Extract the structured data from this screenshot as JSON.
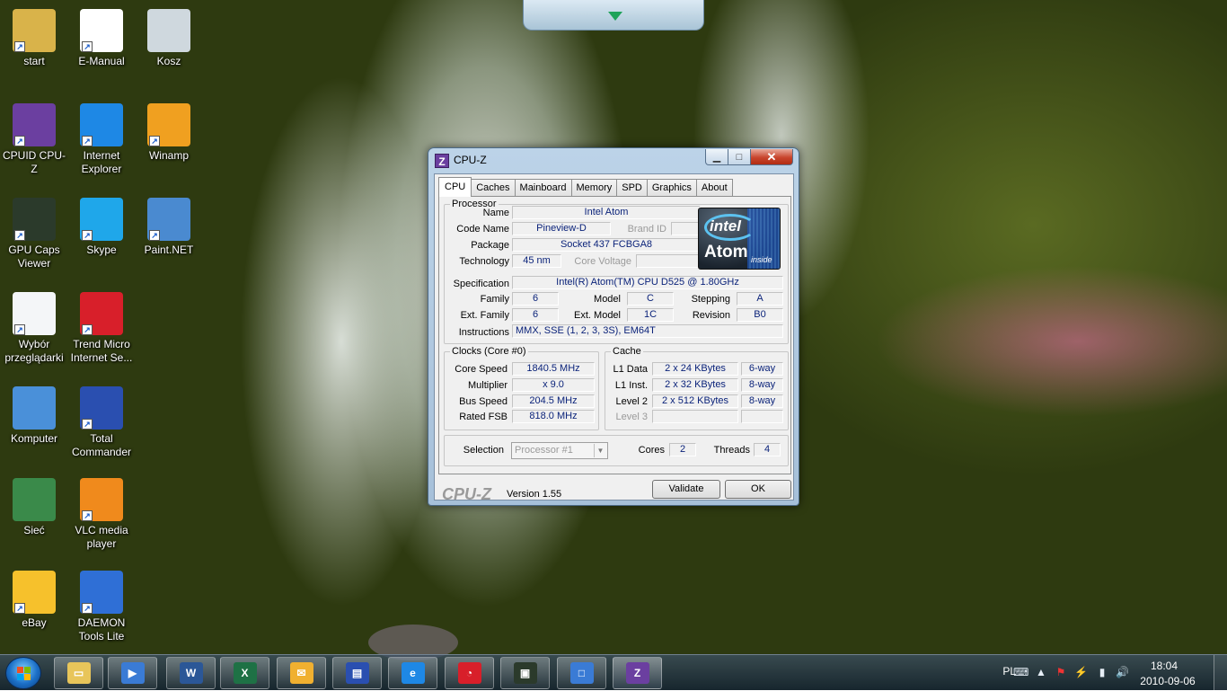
{
  "desktop": {
    "icons": [
      {
        "label": "start",
        "icon": "user-folder-icon",
        "color": "#d9b34a"
      },
      {
        "label": "E-Manual",
        "icon": "pdf-document-icon",
        "color": "#ffffff"
      },
      {
        "label": "Kosz",
        "icon": "recycle-bin-icon",
        "color": "#cfd8de"
      },
      {
        "label": "CPUID CPU-Z",
        "icon": "cpuz-icon",
        "color": "#6b3fa0"
      },
      {
        "label": "Internet Explorer",
        "icon": "internet-explorer-icon",
        "color": "#1e88e5"
      },
      {
        "label": "Winamp",
        "icon": "winamp-icon",
        "color": "#f0a020"
      },
      {
        "label": "GPU Caps Viewer",
        "icon": "gpu-caps-viewer-icon",
        "color": "#2b3a2b"
      },
      {
        "label": "Skype",
        "icon": "skype-icon",
        "color": "#1fa7ea"
      },
      {
        "label": "Paint.NET",
        "icon": "paint-net-icon",
        "color": "#4a8ad0"
      },
      {
        "label": "Wybór przeglądarki",
        "icon": "browser-choice-icon",
        "color": "#f4f6f8"
      },
      {
        "label": "Trend Micro Internet Se...",
        "icon": "trend-micro-icon",
        "color": "#d81f2a"
      },
      {
        "label": "Komputer",
        "icon": "computer-icon",
        "color": "#4a90d9"
      },
      {
        "label": "Total Commander",
        "icon": "total-commander-icon",
        "color": "#2a4fb0"
      },
      {
        "label": "Sieć",
        "icon": "network-icon",
        "color": "#3a8a4a"
      },
      {
        "label": "VLC media player",
        "icon": "vlc-icon",
        "color": "#f08a1c"
      },
      {
        "label": "eBay",
        "icon": "ebay-icon",
        "color": "#f6c12c"
      },
      {
        "label": "DAEMON Tools Lite",
        "icon": "daemon-tools-icon",
        "color": "#2f6fd6"
      }
    ]
  },
  "cpuz": {
    "title": "CPU-Z",
    "app_icon_letter": "Z",
    "tabs": [
      "CPU",
      "Caches",
      "Mainboard",
      "Memory",
      "SPD",
      "Graphics",
      "About"
    ],
    "active_tab": "CPU",
    "processor": {
      "legend": "Processor",
      "name_label": "Name",
      "name": "Intel Atom",
      "code_name_label": "Code Name",
      "code_name": "Pineview-D",
      "brand_id_label": "Brand ID",
      "brand_id": "",
      "package_label": "Package",
      "package": "Socket 437 FCBGA8",
      "technology_label": "Technology",
      "technology": "45 nm",
      "core_voltage_label": "Core Voltage",
      "core_voltage": "",
      "specification_label": "Specification",
      "specification": "Intel(R) Atom(TM) CPU D525   @ 1.80GHz",
      "family_label": "Family",
      "family": "6",
      "model_label": "Model",
      "model": "C",
      "stepping_label": "Stepping",
      "stepping": "A",
      "ext_family_label": "Ext. Family",
      "ext_family": "6",
      "ext_model_label": "Ext. Model",
      "ext_model": "1C",
      "revision_label": "Revision",
      "revision": "B0",
      "instructions_label": "Instructions",
      "instructions": "MMX, SSE (1, 2, 3, 3S), EM64T",
      "logo": {
        "word1": "intel",
        "word2": "Atom",
        "word3": "inside"
      }
    },
    "clocks": {
      "legend": "Clocks (Core #0)",
      "core_speed_label": "Core Speed",
      "core_speed": "1840.5 MHz",
      "multiplier_label": "Multiplier",
      "multiplier": "x 9.0",
      "bus_speed_label": "Bus Speed",
      "bus_speed": "204.5 MHz",
      "rated_fsb_label": "Rated FSB",
      "rated_fsb": "818.0 MHz"
    },
    "cache": {
      "legend": "Cache",
      "rows": [
        {
          "label": "L1 Data",
          "size": "2 x 24 KBytes",
          "way": "6-way"
        },
        {
          "label": "L1 Inst.",
          "size": "2 x 32 KBytes",
          "way": "8-way"
        },
        {
          "label": "Level 2",
          "size": "2 x 512 KBytes",
          "way": "8-way"
        },
        {
          "label": "Level 3",
          "size": "",
          "way": ""
        }
      ]
    },
    "selection_label": "Selection",
    "selection_value": "Processor #1",
    "cores_label": "Cores",
    "cores": "2",
    "threads_label": "Threads",
    "threads": "4",
    "footer_logo": "CPU-Z",
    "version": "Version 1.55",
    "validate_label": "Validate",
    "ok_label": "OK"
  },
  "taskbar": {
    "items": [
      {
        "icon": "windows-explorer-icon",
        "color": "#e8c55a",
        "glyph": "▭",
        "open": false
      },
      {
        "icon": "media-player-icon",
        "color": "#3a7bd5",
        "glyph": "▶",
        "open": false
      },
      {
        "icon": "word-icon",
        "color": "#2b5797",
        "glyph": "W",
        "open": false
      },
      {
        "icon": "excel-icon",
        "color": "#1e7145",
        "glyph": "X",
        "open": false
      },
      {
        "icon": "outlook-icon",
        "color": "#f0b030",
        "glyph": "✉",
        "open": false
      },
      {
        "icon": "total-commander-icon",
        "color": "#2a4fb0",
        "glyph": "▤",
        "open": false
      },
      {
        "icon": "internet-explorer-icon",
        "color": "#1e88e5",
        "glyph": "e",
        "open": false
      },
      {
        "icon": "trend-micro-icon",
        "color": "#d81f2a",
        "glyph": "◔",
        "open": false
      },
      {
        "icon": "gpu-caps-viewer-icon",
        "color": "#2b3a2b",
        "glyph": "▣",
        "open": false
      },
      {
        "icon": "window-icon",
        "color": "#3a7bd5",
        "glyph": "□",
        "open": false
      },
      {
        "icon": "cpuz-icon",
        "color": "#6b3fa0",
        "glyph": "Z",
        "open": true
      }
    ],
    "language": "PL",
    "time": "18:04",
    "date": "2010-09-06"
  }
}
